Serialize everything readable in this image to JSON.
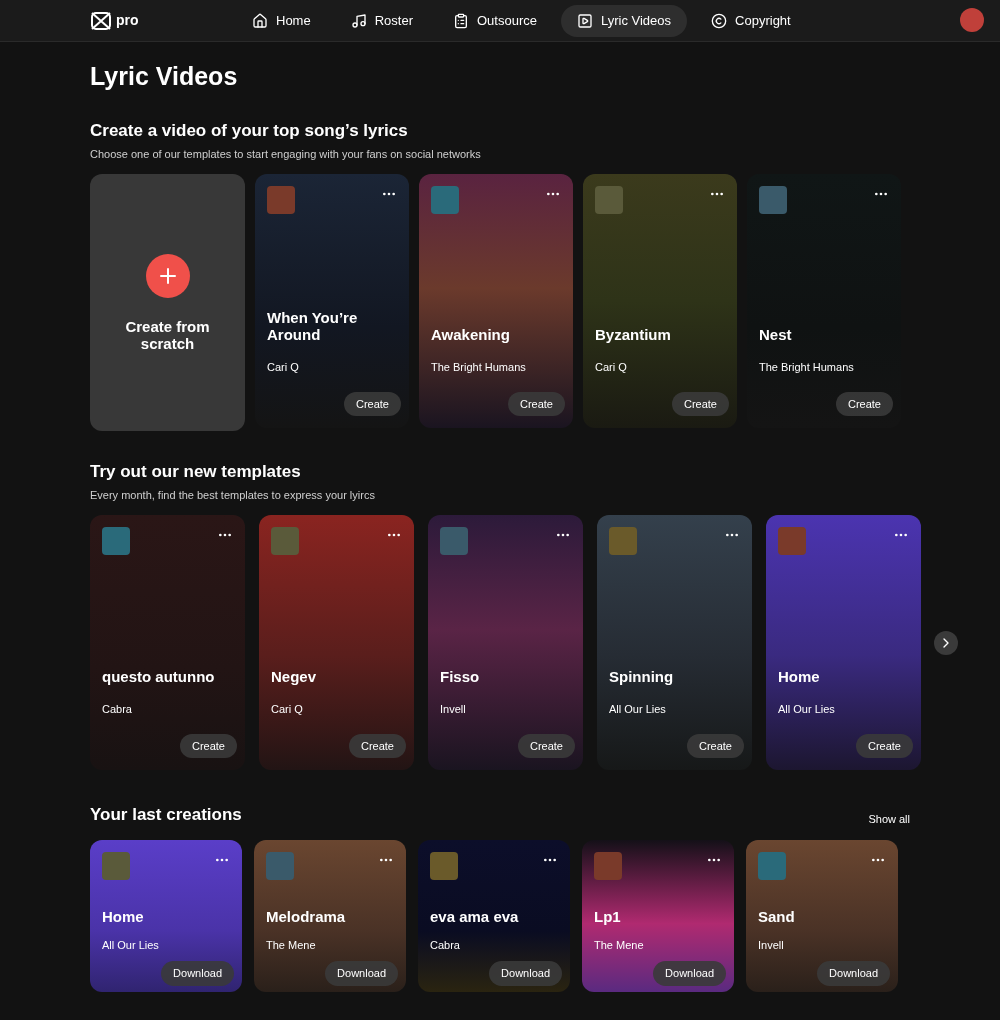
{
  "nav": {
    "logo": "pro",
    "items": [
      {
        "label": "Home",
        "selected": false
      },
      {
        "label": "Roster",
        "selected": false
      },
      {
        "label": "Outsource",
        "selected": false
      },
      {
        "label": "Lyric Videos",
        "selected": true
      },
      {
        "label": "Copyright",
        "selected": false
      }
    ]
  },
  "page_title": "Lyric Videos",
  "top_templates": {
    "title": "Create a video of your top song’s lyrics",
    "subtitle": "Choose one of our templates to start engaging with your fans on social networks",
    "create_card": {
      "label": "Create from scratch"
    },
    "cards": [
      {
        "title": "When You’re Around",
        "artist": "Cari Q",
        "button": "Create"
      },
      {
        "title": "Awakening",
        "artist": "The Bright Humans",
        "button": "Create"
      },
      {
        "title": "Byzantium",
        "artist": "Cari Q",
        "button": "Create"
      },
      {
        "title": "Nest",
        "artist": "The Bright Humans",
        "button": "Create"
      }
    ]
  },
  "new_templates": {
    "title": "Try out our new templates",
    "subtitle": "Every month, find the best templates to express your lyircs",
    "cards": [
      {
        "title": "questo autunno",
        "artist": "Cabra",
        "button": "Create"
      },
      {
        "title": "Negev",
        "artist": "Cari Q",
        "button": "Create"
      },
      {
        "title": "Fisso",
        "artist": "Invell",
        "button": "Create"
      },
      {
        "title": "Spinning",
        "artist": "All Our Lies",
        "button": "Create"
      },
      {
        "title": "Home",
        "artist": "All Our Lies",
        "button": "Create"
      }
    ]
  },
  "last_creations": {
    "title": "Your last creations",
    "show_all": "Show all",
    "cards": [
      {
        "title": "Home",
        "artist": "All Our Lies",
        "button": "Download"
      },
      {
        "title": "Melodrama",
        "artist": "The Mene",
        "button": "Download"
      },
      {
        "title": "eva ama eva",
        "artist": "Cabra",
        "button": "Download"
      },
      {
        "title": "Lp1",
        "artist": "The Mene",
        "button": "Download"
      },
      {
        "title": "Sand",
        "artist": "Invell",
        "button": "Download"
      }
    ]
  }
}
